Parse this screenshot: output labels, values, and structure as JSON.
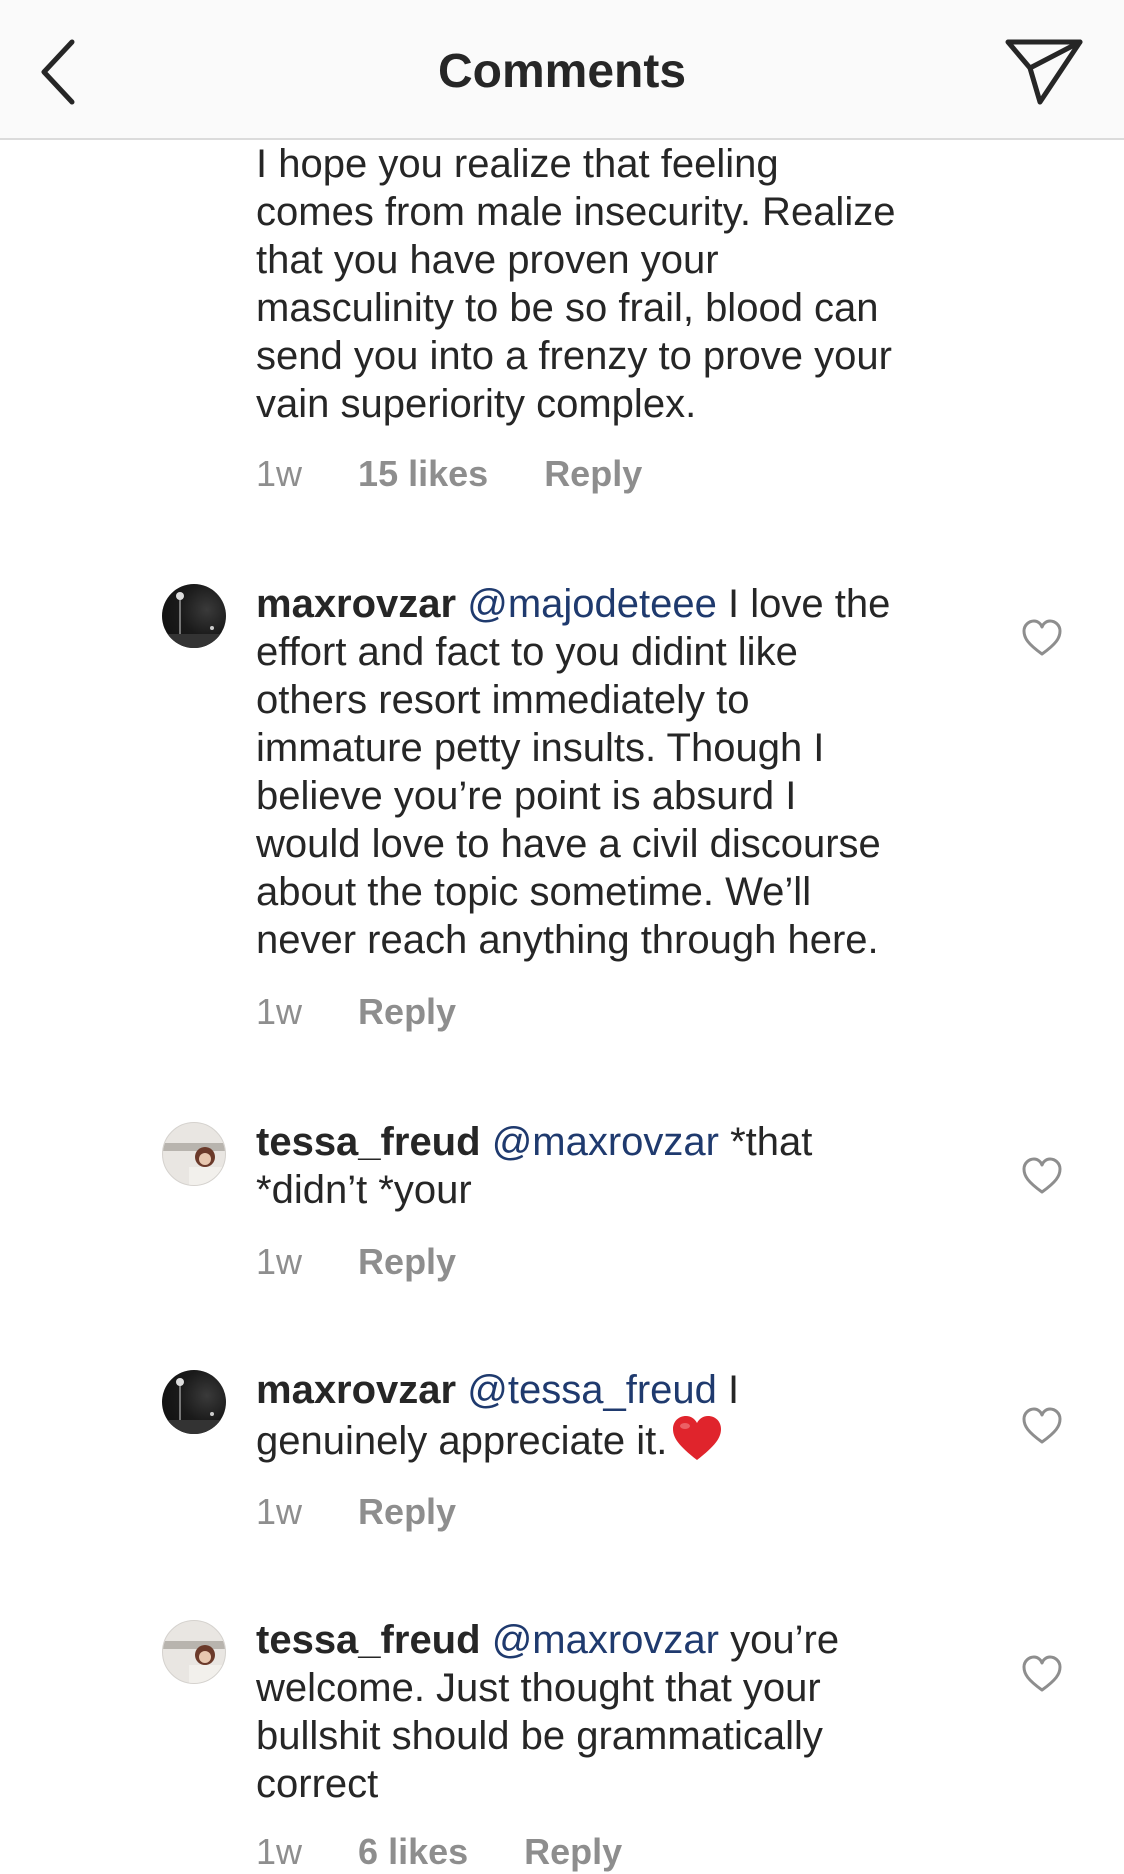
{
  "header": {
    "title": "Comments"
  },
  "icons": {
    "back": "chevron-left-icon",
    "send": "paper-plane-icon",
    "like": "heart-outline-icon",
    "emoji": "red-heart-emoji"
  },
  "colors": {
    "mention": "#1f3a6e",
    "meta": "#8e8e8e",
    "text": "#262626",
    "header_bg": "#fafafa",
    "emoji_red": "#e0242c"
  },
  "partial_comment": {
    "text": "I hope you realize that feeling\ncomes from male insecurity. Realize\nthat you have proven your\nmasculinity to be so frail, blood can\nsend you into a frenzy to prove your\nvain superiority complex.",
    "time": "1w",
    "likes": "15 likes",
    "reply": "Reply"
  },
  "comments": [
    {
      "username": "maxrovzar",
      "mention": "@majodeteee",
      "text": " I love the\neffort and fact to you didint like\nothers resort immediately to\nimmature petty insults. Though I\nbelieve you’re point is absurd I\nwould love to have a civil discourse\nabout the topic sometime. We’ll\nnever reach anything through here.",
      "time": "1w",
      "reply": "Reply"
    },
    {
      "username": "tessa_freud",
      "mention": "@maxrovzar",
      "text": " *that\n*didn’t *your",
      "time": "1w",
      "reply": "Reply"
    },
    {
      "username": "maxrovzar",
      "mention": "@tessa_freud",
      "text": " I\ngenuinely appreciate it.",
      "time": "1w",
      "reply": "Reply"
    },
    {
      "username": "tessa_freud",
      "mention": "@maxrovzar",
      "text": " you’re\nwelcome. Just thought that your\nbullshit should be grammatically\ncorrect",
      "time": "1w",
      "likes": "6 likes",
      "reply": "Reply"
    }
  ]
}
